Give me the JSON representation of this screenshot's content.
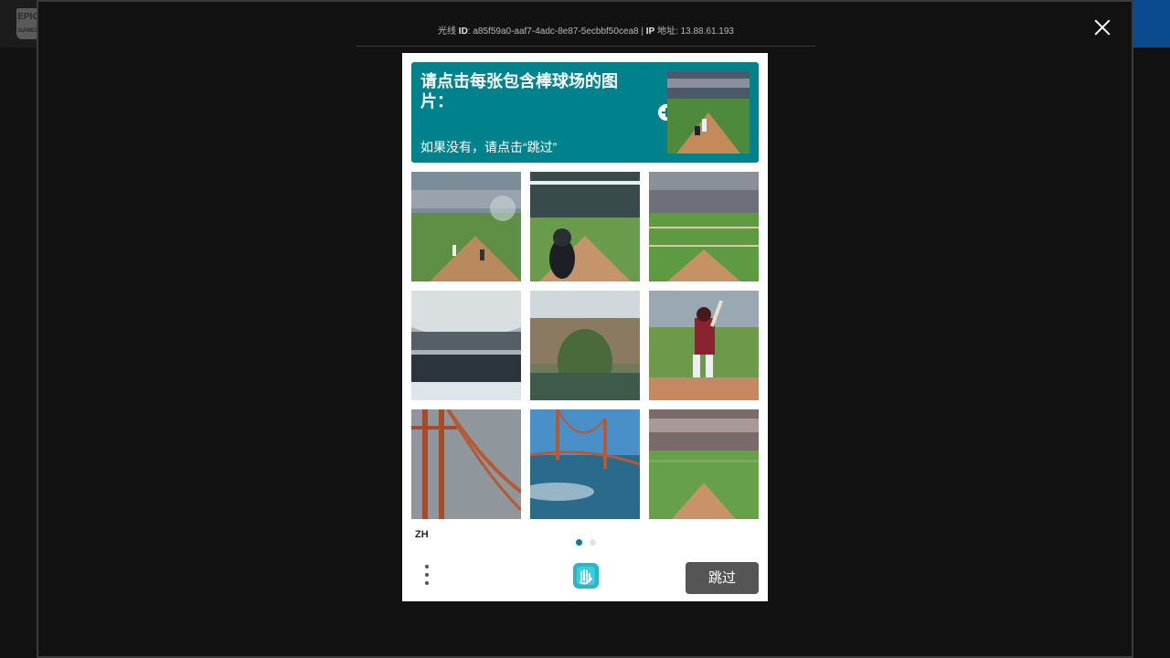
{
  "background": {
    "logo_text": "EPIC GAMES"
  },
  "modal": {
    "ray_id_prefix": "光线",
    "ray_id_label": "ID",
    "ray_id_value": "a85f59a0-aaf7-4adc-8e87-5ecbbf50cea8",
    "separator": "|",
    "ip_label": "IP",
    "ip_suffix": "地址",
    "ip_value": "13.88.61.193"
  },
  "captcha": {
    "prompt_title": "请点击每张包含棒球场的图片：",
    "prompt_subtitle": "如果没有，请点击“跳过”",
    "tiles": [
      {
        "label": "stadium-batter"
      },
      {
        "label": "stadium-spectator"
      },
      {
        "label": "stadium-wide"
      },
      {
        "label": "stadium-blurry"
      },
      {
        "label": "stone-bridge"
      },
      {
        "label": "batter-closeup"
      },
      {
        "label": "golden-gate-fog"
      },
      {
        "label": "golden-gate-water"
      },
      {
        "label": "stadium-aerial"
      }
    ],
    "language": "ZH",
    "pages": 2,
    "current_page": 1,
    "next_button": "跳过",
    "colors": {
      "accent": "#00828c",
      "button": "#555555"
    }
  }
}
